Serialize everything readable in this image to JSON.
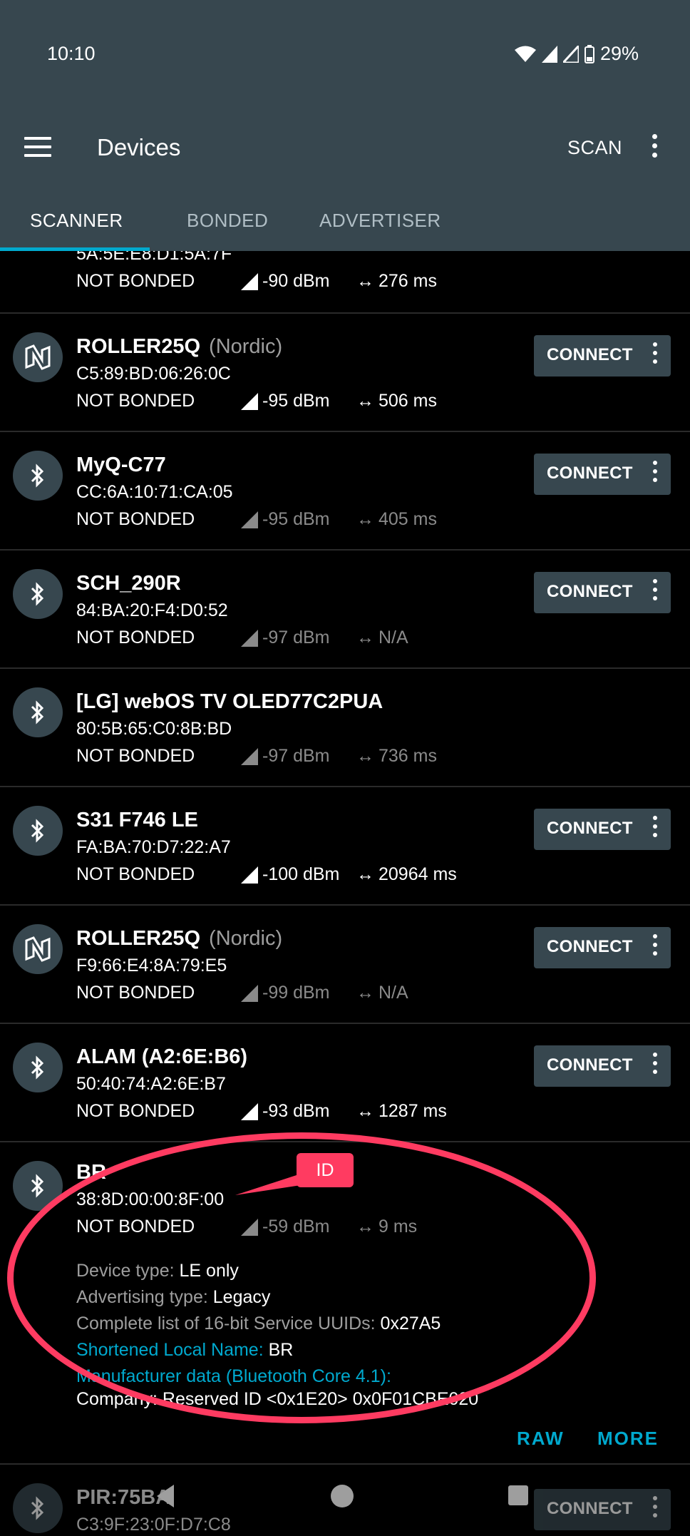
{
  "status_bar": {
    "time": "10:10",
    "battery": "29%"
  },
  "app_bar": {
    "title": "Devices",
    "scan_label": "SCAN"
  },
  "tabs": [
    {
      "label": "SCANNER"
    },
    {
      "label": "BONDED"
    },
    {
      "label": "ADVERTISER"
    }
  ],
  "partial_row": {
    "address": "5A:5E:E8:D1:5A:7F",
    "bond": "NOT BONDED",
    "rssi": "-90 dBm",
    "interval": "276 ms"
  },
  "devices": [
    {
      "name": "ROLLER25Q",
      "vendor": "(Nordic)",
      "address": "C5:89:BD:06:26:0C",
      "bond": "NOT BONDED",
      "rssi": "-95 dBm",
      "interval": "506 ms",
      "connect": "CONNECT",
      "icon": "nordic-icon"
    },
    {
      "name": "MyQ-C77",
      "address": "CC:6A:10:71:CA:05",
      "bond": "NOT BONDED",
      "rssi": "-95 dBm",
      "interval": "405 ms",
      "connect": "CONNECT",
      "icon": "bluetooth-icon"
    },
    {
      "name": "SCH_290R",
      "address": "84:BA:20:F4:D0:52",
      "bond": "NOT BONDED",
      "rssi": "-97 dBm",
      "interval": "N/A",
      "connect": "CONNECT",
      "icon": "bluetooth-icon"
    },
    {
      "name": "[LG] webOS TV OLED77C2PUA",
      "address": "80:5B:65:C0:8B:BD",
      "bond": "NOT BONDED",
      "rssi": "-97 dBm",
      "interval": "736 ms",
      "icon": "bluetooth-icon"
    },
    {
      "name": "S31 F746 LE",
      "address": "FA:BA:70:D7:22:A7",
      "bond": "NOT BONDED",
      "rssi": "-100 dBm",
      "interval": "20964 ms",
      "connect": "CONNECT",
      "icon": "bluetooth-icon"
    },
    {
      "name": "ROLLER25Q",
      "vendor": "(Nordic)",
      "address": "F9:66:E4:8A:79:E5",
      "bond": "NOT BONDED",
      "rssi": "-99 dBm",
      "interval": "N/A",
      "connect": "CONNECT",
      "icon": "nordic-icon"
    },
    {
      "name": "ALAM (A2:6E:B6)",
      "address": "50:40:74:A2:6E:B7",
      "bond": "NOT BONDED",
      "rssi": "-93 dBm",
      "interval": "1287 ms",
      "connect": "CONNECT",
      "icon": "bluetooth-icon"
    }
  ],
  "expanded_device": {
    "name": "BR",
    "address": "38:8D:00:00:8F:00",
    "bond": "NOT BONDED",
    "rssi": "-59 dBm",
    "interval": "9 ms",
    "details": {
      "device_type_key": "Device type:",
      "device_type_val": "LE only",
      "adv_type_key": "Advertising type:",
      "adv_type_val": "Legacy",
      "uuids_key": "Complete list of 16-bit Service UUIDs:",
      "uuids_val": "0x27A5",
      "local_name_key": "Shortened Local Name:",
      "local_name_val": "BR",
      "manufacturer_key": "Manufacturer data (Bluetooth Core 4.1):",
      "manufacturer_val": "Company: Reserved ID <0x1E20> 0x0F01CBE020"
    },
    "raw_label": "RAW",
    "more_label": "MORE"
  },
  "annotation": {
    "tag": "ID",
    "color": "#ff3b61"
  },
  "last_row": {
    "name": "PIR:75BA",
    "address": "C3:9F:23:0F:D7:C8",
    "connect": "CONNECT"
  },
  "colors": {
    "app_bar": "#37474f",
    "accent": "#00a9ce",
    "button": "#37474f",
    "background": "#000000"
  }
}
